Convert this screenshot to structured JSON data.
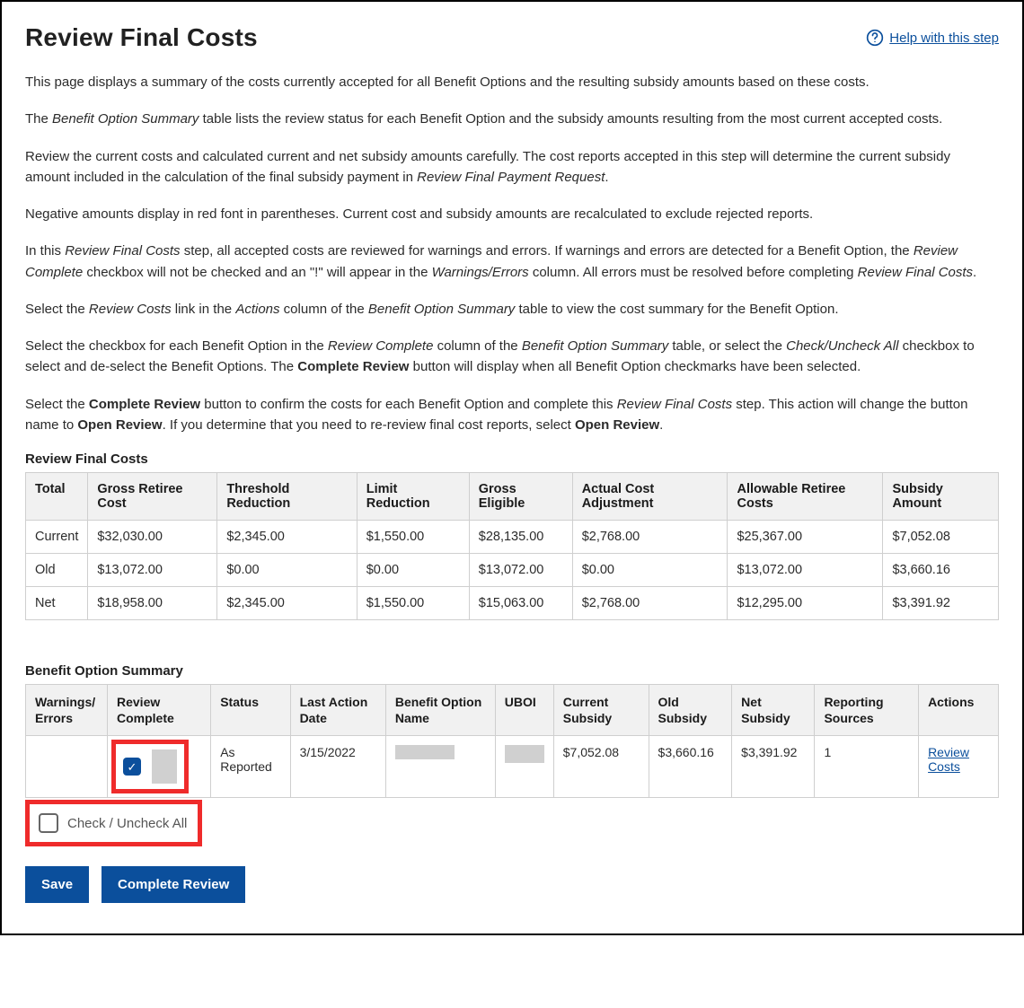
{
  "header": {
    "title": "Review Final Costs",
    "help_label": "Help with this step"
  },
  "intro": {
    "p1_pre": "This page displays a summary of the costs currently accepted for all Benefit Options and the resulting subsidy amounts based on these costs.",
    "p2_pre": "The ",
    "p2_em": "Benefit Option Summary",
    "p2_post": " table lists the review status for each Benefit Option and the subsidy amounts resulting from the most current accepted costs.",
    "p3_pre": "Review the current costs and calculated current and net subsidy amounts carefully. The cost reports accepted in this step will determine the current subsidy amount included in the calculation of the final subsidy payment in ",
    "p3_em": "Review Final Payment Request",
    "p3_post": ".",
    "p4": "Negative amounts display in red font in parentheses. Current cost and subsidy amounts are recalculated to exclude rejected reports.",
    "p5_pre": "In this ",
    "p5_em1": "Review Final Costs",
    "p5_mid1": " step, all accepted costs are reviewed for warnings and errors. If warnings and errors are detected for a Benefit Option, the ",
    "p5_em2": "Review Complete",
    "p5_mid2": " checkbox will not be checked and an \"!\" will appear in the ",
    "p5_em3": "Warnings/Errors",
    "p5_mid3": " column. All errors must be resolved before completing ",
    "p5_em4": "Review Final Costs",
    "p5_post": ".",
    "p6_pre": "Select the ",
    "p6_em1": "Review Costs",
    "p6_mid1": " link in the ",
    "p6_em2": "Actions",
    "p6_mid2": " column of the ",
    "p6_em3": "Benefit Option Summary",
    "p6_post": " table to view the cost summary for the Benefit Option.",
    "p7_pre": "Select the checkbox for each Benefit Option in the ",
    "p7_em1": "Review Complete",
    "p7_mid1": " column of the ",
    "p7_em2": "Benefit Option Summary",
    "p7_mid2": " table, or select the ",
    "p7_em3": "Check/Uncheck All",
    "p7_mid3": " checkbox to select and de-select the Benefit Options. The ",
    "p7_strong": "Complete Review",
    "p7_post": " button will display when all Benefit Option checkmarks have been selected.",
    "p8_pre": "Select the ",
    "p8_strong1": "Complete Review",
    "p8_mid1": " button to confirm the costs for each Benefit Option and complete this ",
    "p8_em1": "Review Final Costs",
    "p8_mid2": " step. This action will change the button name to ",
    "p8_strong2": "Open Review",
    "p8_mid3": ". If you determine that you need to re-review final cost reports, select ",
    "p8_strong3": "Open Review",
    "p8_post": "."
  },
  "costs_table": {
    "title": "Review Final Costs",
    "headers": {
      "total": "Total",
      "gross_retiree": "Gross Retiree Cost",
      "threshold": "Threshold Reduction",
      "limit": "Limit Reduction",
      "gross_eligible": "Gross Eligible",
      "actual_adj": "Actual Cost Adjustment",
      "allowable": "Allowable Retiree Costs",
      "subsidy": "Subsidy Amount"
    },
    "rows": [
      {
        "total": "Current",
        "gross_retiree": "$32,030.00",
        "threshold": "$2,345.00",
        "limit": "$1,550.00",
        "gross_eligible": "$28,135.00",
        "actual_adj": "$2,768.00",
        "allowable": "$25,367.00",
        "subsidy": "$7,052.08"
      },
      {
        "total": "Old",
        "gross_retiree": "$13,072.00",
        "threshold": "$0.00",
        "limit": "$0.00",
        "gross_eligible": "$13,072.00",
        "actual_adj": "$0.00",
        "allowable": "$13,072.00",
        "subsidy": "$3,660.16"
      },
      {
        "total": "Net",
        "gross_retiree": "$18,958.00",
        "threshold": "$2,345.00",
        "limit": "$1,550.00",
        "gross_eligible": "$15,063.00",
        "actual_adj": "$2,768.00",
        "allowable": "$12,295.00",
        "subsidy": "$3,391.92"
      }
    ]
  },
  "bos_table": {
    "title": "Benefit Option Summary",
    "headers": {
      "warnings": "Warnings/ Errors",
      "review_complete": "Review Complete",
      "status": "Status",
      "last_action": "Last Action Date",
      "bon": "Benefit Option Name",
      "uboi": "UBOI",
      "current_subsidy": "Current Subsidy",
      "old_subsidy": "Old Subsidy",
      "net_subsidy": "Net Subsidy",
      "reporting_sources": "Reporting Sources",
      "actions": "Actions"
    },
    "row": {
      "status": "As Reported",
      "last_action": "3/15/2022",
      "current_subsidy": "$7,052.08",
      "old_subsidy": "$3,660.16",
      "net_subsidy": "$3,391.92",
      "reporting_sources": "1",
      "action_link": "Review Costs"
    }
  },
  "check_all_label": "Check / Uncheck All",
  "buttons": {
    "save": "Save",
    "complete": "Complete Review"
  }
}
